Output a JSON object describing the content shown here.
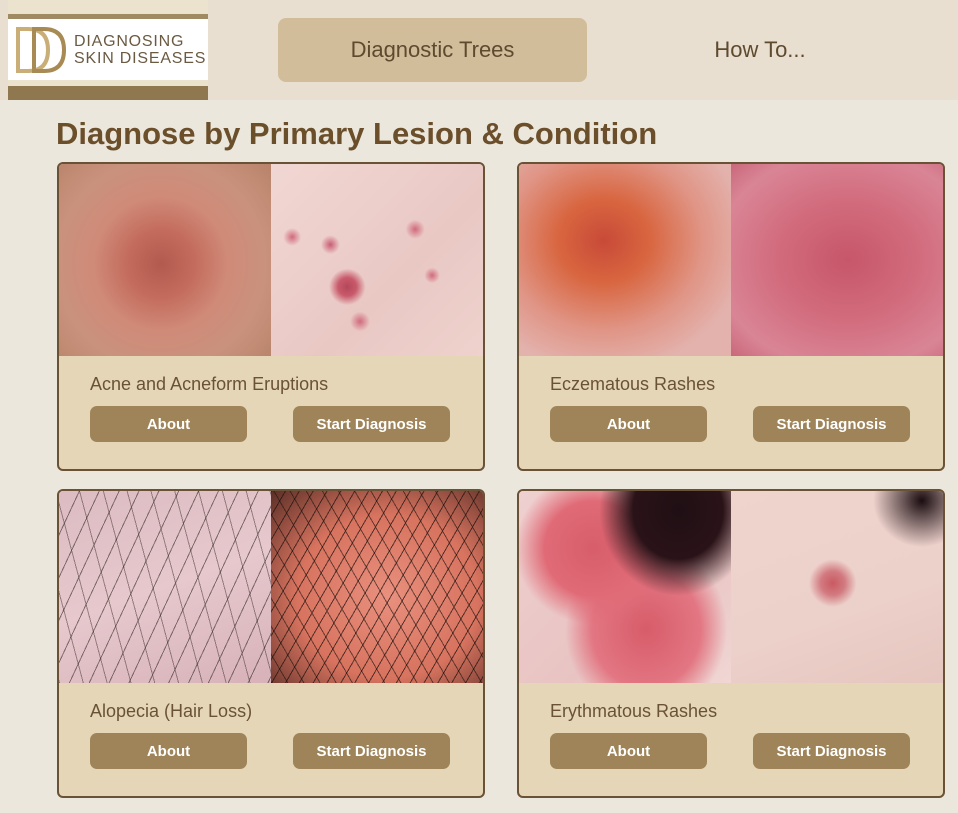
{
  "brand": {
    "logo_line1": "DIAGNOSING",
    "logo_line2": "SKIN DISEASES",
    "logo_mark": "DD"
  },
  "nav": {
    "items": [
      {
        "label": "Diagnostic Trees",
        "active": true
      },
      {
        "label": "How To...",
        "active": false
      }
    ]
  },
  "main": {
    "title": "Diagnose by Primary Lesion & Condition",
    "cards": [
      {
        "name": "Acne and Acneform Eruptions",
        "about_label": "About",
        "start_label": "Start Diagnosis"
      },
      {
        "name": "Eczematous Rashes",
        "about_label": "About",
        "start_label": "Start Diagnosis"
      },
      {
        "name": "Alopecia (Hair Loss)",
        "about_label": "About",
        "start_label": "Start Diagnosis"
      },
      {
        "name": "Erythmatous Rashes",
        "about_label": "About",
        "start_label": "Start Diagnosis"
      }
    ]
  },
  "colors": {
    "page_bg": "#ece7dd",
    "header_bg": "#e8dfd1",
    "nav_active_bg": "#d2bd9b",
    "title_text": "#6b4e2a",
    "card_bg": "#e6d6b8",
    "card_border": "#6a5236",
    "button_bg": "#9f8459",
    "button_text": "#ffffff"
  }
}
